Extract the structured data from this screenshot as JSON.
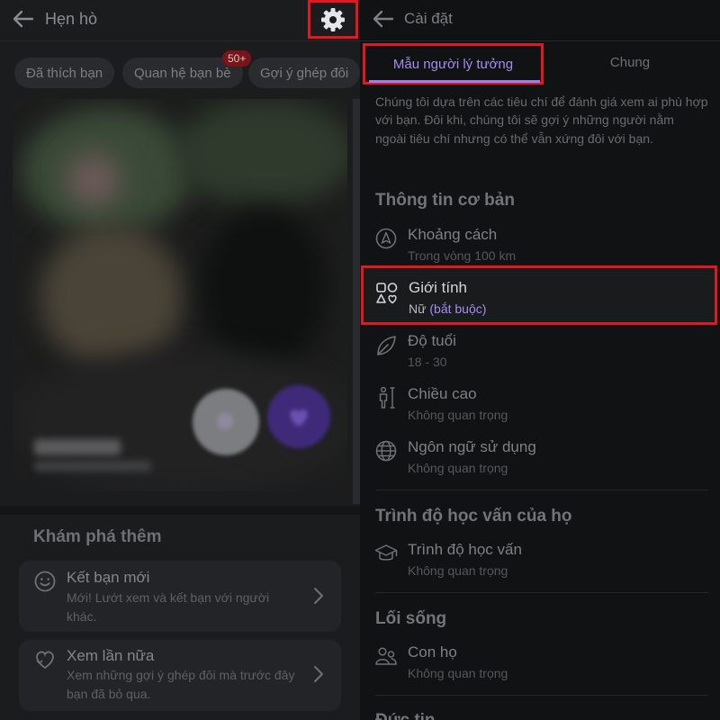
{
  "left": {
    "header": {
      "title": "Hẹn hò"
    },
    "chips": [
      {
        "label": "Đã thích bạn"
      },
      {
        "label": "Quan hệ bạn bè",
        "badge": "50+"
      },
      {
        "label": "Gợi ý ghép đôi"
      }
    ],
    "explore": {
      "title": "Khám phá thêm",
      "cards": [
        {
          "title": "Kết bạn mới",
          "desc": "Mới! Lướt xem và kết bạn với người khác."
        },
        {
          "title": "Xem lần nữa",
          "desc": "Xem những gợi ý ghép đôi mà trước đây bạn đã bỏ qua."
        }
      ]
    }
  },
  "right": {
    "header": {
      "title": "Cài đặt"
    },
    "tabs": [
      {
        "label": "Mẫu người lý tưởng",
        "active": true
      },
      {
        "label": "Chung",
        "active": false
      }
    ],
    "intro": "Chúng tôi dựa trên các tiêu chí để đánh giá xem ai phù hợp với bạn. Đôi khi, chúng tôi sẽ gợi ý những người nằm ngoài tiêu chí nhưng có thể vẫn xứng đôi với bạn.",
    "sections": [
      {
        "title": "Thông tin cơ bản",
        "rows": [
          {
            "icon": "navigation-icon",
            "title": "Khoảng cách",
            "sub": "Trong vòng 100 km"
          },
          {
            "icon": "shapes-icon",
            "title": "Giới tính",
            "sub": "Nữ",
            "sub_extra": "(bắt buộc)",
            "highlighted": true
          },
          {
            "icon": "leaf-icon",
            "title": "Độ tuổi",
            "sub": "18 - 30"
          },
          {
            "icon": "height-icon",
            "title": "Chiều cao",
            "sub": "Không quan trọng"
          },
          {
            "icon": "globe-icon",
            "title": "Ngôn ngữ sử dụng",
            "sub": "Không quan trọng"
          }
        ]
      },
      {
        "title": "Trình độ học vấn của họ",
        "rows": [
          {
            "icon": "graduation-cap-icon",
            "title": "Trình độ học vấn",
            "sub": "Không quan trọng"
          }
        ]
      },
      {
        "title": "Lối sống",
        "rows": [
          {
            "icon": "people-icon",
            "title": "Con họ",
            "sub": "Không quan trọng"
          }
        ]
      },
      {
        "title": "Đức tin"
      }
    ]
  },
  "colors": {
    "accent": "#9b7ef0",
    "highlight_box": "#e0181f",
    "badge": "#7a1418"
  }
}
